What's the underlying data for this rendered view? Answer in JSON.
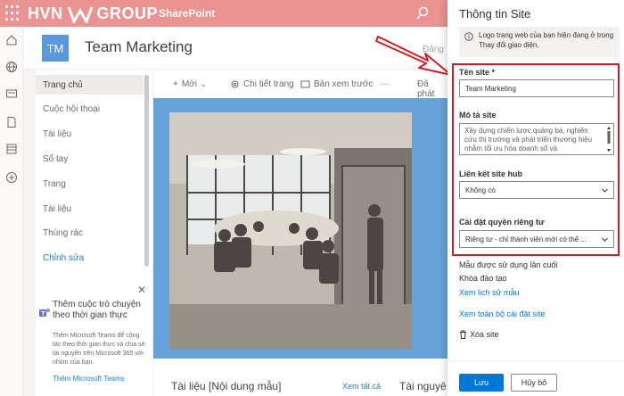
{
  "header": {
    "brand_left": "HVN",
    "brand_right": "GROUP",
    "app_name": "SharePoint"
  },
  "site": {
    "initials": "TM",
    "title": "Team Marketing",
    "follow_partial": "Đăng th"
  },
  "nav": {
    "items": [
      {
        "label": "Trang chủ"
      },
      {
        "label": "Cuộc hội thoại"
      },
      {
        "label": "Tài liệu"
      },
      {
        "label": "Sổ tay"
      },
      {
        "label": "Trang"
      },
      {
        "label": "Tài liệu"
      },
      {
        "label": "Thùng rác"
      },
      {
        "label": "Chỉnh sửa"
      }
    ]
  },
  "teams_promo": {
    "title": "Thêm cuộc trò chuyện theo thời gian thực",
    "description": "Thêm Microsoft Teams để cộng tác theo thời gian thực và chia sẻ tài nguyên trên Microsoft 365 với nhóm của bạn.",
    "link": "Thêm Microsoft Teams"
  },
  "commands": {
    "new": "Mới",
    "page_details": "Chi tiết trang",
    "preview": "Bản xem trước",
    "more": "···",
    "published": "Đã phát"
  },
  "main": {
    "docs_title": "Tài liệu [Nội dung mẫu]",
    "see_all": "Xem tất cả",
    "resources_title": "Tài nguyê"
  },
  "panel": {
    "title": "Thông tin Site",
    "info": "Logo trang web của bạn hiện đang ở trong Thay đổi giao diện.",
    "site_name_label": "Tên site *",
    "site_name_value": "Team Marketing",
    "description_label": "Mô tả site",
    "description_value": "Xây dựng chiến lược quảng bá, nghiên cứu thị trường và phát triển thương hiệu nhằm tối ưu hóa doanh số và",
    "hub_label": "Liên kết site hub",
    "hub_value": "Không có",
    "privacy_label": "Cài đặt quyền riêng tư",
    "privacy_value": "Riêng tư - chỉ thành viên mới có thể ...",
    "template_label": "Mẫu được sử dụng lần cuối",
    "template_value": "Khóa đào tạo",
    "template_history": "Xem lịch sử mẫu",
    "all_settings": "Xem toàn bộ cài đặt site",
    "delete": "Xóa site",
    "save": "Lưu",
    "cancel": "Hủy bỏ"
  },
  "colors": {
    "header": "#e98a87",
    "accent": "#0078d4",
    "highlight": "#d01c24",
    "tile": "#4a90d9"
  }
}
